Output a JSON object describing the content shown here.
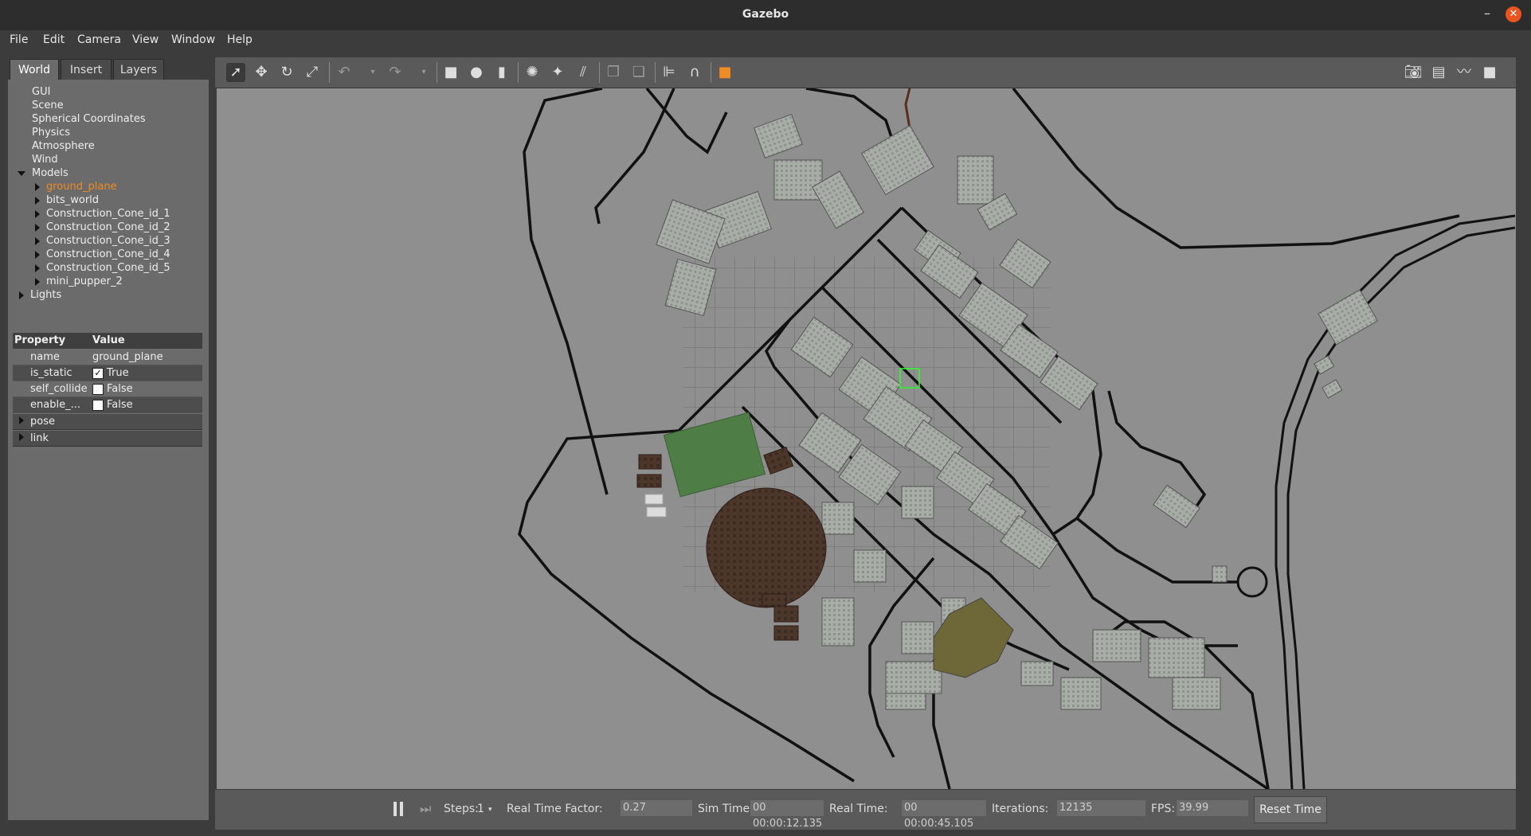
{
  "window": {
    "title": "Gazebo",
    "minimize": "–",
    "close": "✕"
  },
  "menu": [
    "File",
    "Edit",
    "Camera",
    "View",
    "Window",
    "Help"
  ],
  "tabs": [
    "World",
    "Insert",
    "Layers"
  ],
  "tree": {
    "items": [
      "GUI",
      "Scene",
      "Spherical Coordinates",
      "Physics",
      "Atmosphere",
      "Wind"
    ],
    "models_label": "Models",
    "models": [
      "ground_plane",
      "bits_world",
      "Construction_Cone_id_1",
      "Construction_Cone_id_2",
      "Construction_Cone_id_3",
      "Construction_Cone_id_4",
      "Construction_Cone_id_5",
      "mini_pupper_2"
    ],
    "lights_label": "Lights"
  },
  "properties": {
    "header_property": "Property",
    "header_value": "Value",
    "rows": [
      {
        "key": "name",
        "value": "ground_plane"
      },
      {
        "key": "is_static",
        "value": "True",
        "checked": true
      },
      {
        "key": "self_collide",
        "value": "False",
        "checked": false
      },
      {
        "key": "enable_...",
        "value": "False",
        "checked": false
      }
    ],
    "expandable": [
      "pose",
      "link"
    ]
  },
  "toolbar": {
    "left_icons": [
      "select-icon",
      "translate-icon",
      "rotate-icon",
      "scale-icon",
      "undo-icon",
      "redo-icon",
      "box-icon",
      "sphere-icon",
      "cylinder-icon",
      "point-light-icon",
      "spot-light-icon",
      "directional-light-icon",
      "copy-icon",
      "paste-icon",
      "align-icon",
      "snap-icon",
      "view-angle-icon"
    ],
    "right_icons": [
      "screenshot-icon",
      "log-icon",
      "plot-icon",
      "record-icon"
    ]
  },
  "bottom": {
    "steps_label": "Steps:",
    "steps_value": "1",
    "rtf_label": "Real Time Factor:",
    "rtf_value": "0.27",
    "sim_label": "Sim Time:",
    "sim_value": "00 00:00:12.135",
    "real_label": "Real Time:",
    "real_value": "00 00:00:45.105",
    "iter_label": "Iterations:",
    "iter_value": "12135",
    "fps_label": "FPS:",
    "fps_value": "39.99",
    "reset_label": "Reset Time"
  },
  "colors": {
    "accent": "#f08a24",
    "close": "#e95420",
    "scene_bg": "#8f8f8f",
    "field_green": "#4e7e45",
    "track_brown": "#4a3426",
    "pond": "#6e6838"
  }
}
